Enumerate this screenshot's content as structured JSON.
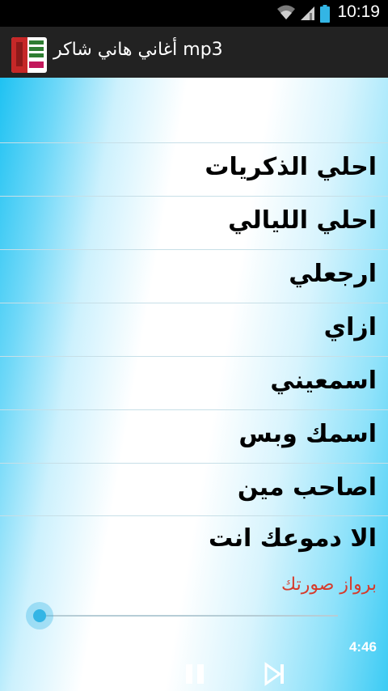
{
  "status_bar": {
    "time": "10:19",
    "icons": [
      "wifi-icon",
      "signal-icon",
      "battery-icon"
    ]
  },
  "action_bar": {
    "title": "أغاني هاني شاكر mp3",
    "icon": "app-icon"
  },
  "songs": [
    {
      "label": "احلي الذكريات"
    },
    {
      "label": "احلي الليالي"
    },
    {
      "label": "ارجعلي"
    },
    {
      "label": "ازاي"
    },
    {
      "label": "اسمعيني"
    },
    {
      "label": "اسمك وبس"
    },
    {
      "label": "اصاحب مين"
    }
  ],
  "player": {
    "now_playing": "الا دموعك انت",
    "link_text": "برواز صورتك",
    "duration": "4:46",
    "progress": 0.0,
    "controls": [
      "previous-icon",
      "pause-icon",
      "next-icon"
    ]
  },
  "colors": {
    "accent": "#33b5e5",
    "link": "#d63b2c",
    "action_bar_bg": "#222222"
  }
}
